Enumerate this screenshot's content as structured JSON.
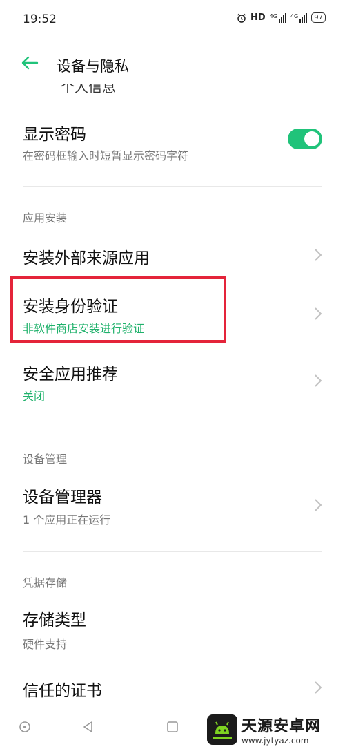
{
  "status": {
    "time": "19:52",
    "hd": "HD",
    "net1": "4G",
    "net2": "4G",
    "battery": "97"
  },
  "header": {
    "title": "设备与隐私"
  },
  "prev_item_partial": "个人信息",
  "items": {
    "show_password": {
      "title": "显示密码",
      "subtitle": "在密码框输入时短暂显示密码字符",
      "enabled": true
    },
    "install_external": {
      "title": "安装外部来源应用"
    },
    "install_verify": {
      "title": "安装身份验证",
      "subtitle": "非软件商店安装进行验证"
    },
    "security_recommend": {
      "title": "安全应用推荐",
      "subtitle": "关闭"
    },
    "device_admin": {
      "title": "设备管理器",
      "subtitle": "1 个应用正在运行"
    },
    "storage_type": {
      "title": "存储类型",
      "subtitle": "硬件支持"
    },
    "trusted_certs": {
      "title": "信任的证书"
    }
  },
  "sections": {
    "app_install": "应用安装",
    "device_mgmt": "设备管理",
    "credential_storage": "凭据存储"
  },
  "watermark": {
    "name": "天源安卓网",
    "url": "www.jytyaz.com"
  },
  "colors": {
    "accent": "#20c37a",
    "highlight": "#e4243a"
  }
}
